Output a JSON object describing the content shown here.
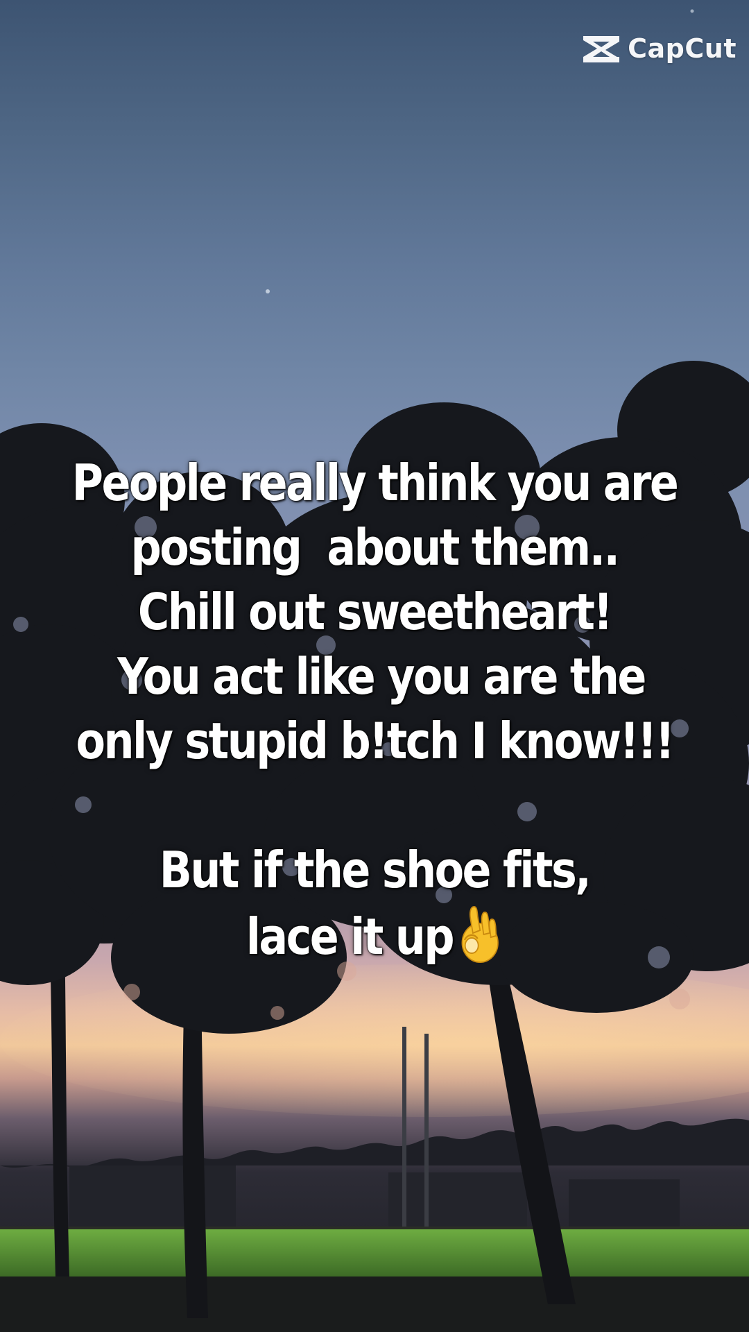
{
  "watermark": {
    "brand": "CapCut",
    "icon": "capcut-logo-icon"
  },
  "caption": {
    "lines": [
      "People really think you are",
      "posting  about them..",
      "Chill out sweetheart!",
      " You act like you are the",
      "only stupid b!tch I know!!!",
      "",
      "But if the shoe fits,",
      "lace it up"
    ],
    "emoji": "ok-hand-icon"
  },
  "colors": {
    "sky_top": "#3d5472",
    "sky_mid": "#7d8fb0",
    "sunset_glow": "#f0c79b",
    "tree_silhouette": "#15171c",
    "field_grass": "#5f9a3a",
    "text": "#ffffff"
  }
}
